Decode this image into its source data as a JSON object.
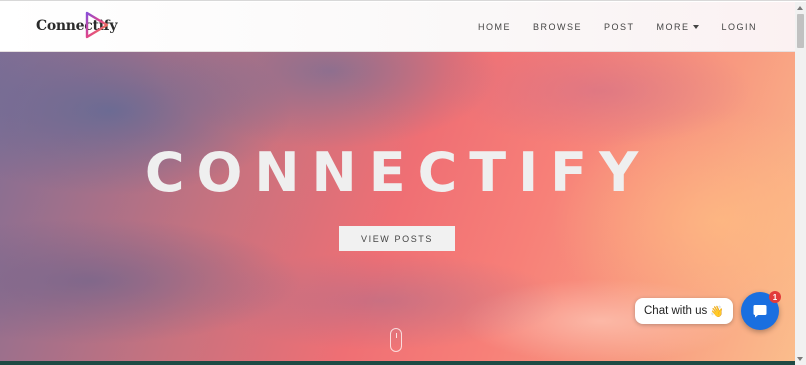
{
  "logo": {
    "text": "Connectify",
    "icon": "play-triangle-logo-icon"
  },
  "nav": {
    "items": [
      {
        "label": "HOME"
      },
      {
        "label": "BROWSE"
      },
      {
        "label": "POST"
      },
      {
        "label": "MORE"
      },
      {
        "label": "LOGIN"
      }
    ]
  },
  "hero": {
    "title": "CONNECTIFY",
    "button_label": "VIEW POSTS"
  },
  "chat": {
    "bubble_text": "Chat with us",
    "wave_icon": "👋",
    "badge_count": "1",
    "button_color": "#1a6fe0"
  },
  "colors": {
    "accent": "#1a6fe0",
    "badge": "#e23b3b",
    "footer": "#1e4a44"
  }
}
